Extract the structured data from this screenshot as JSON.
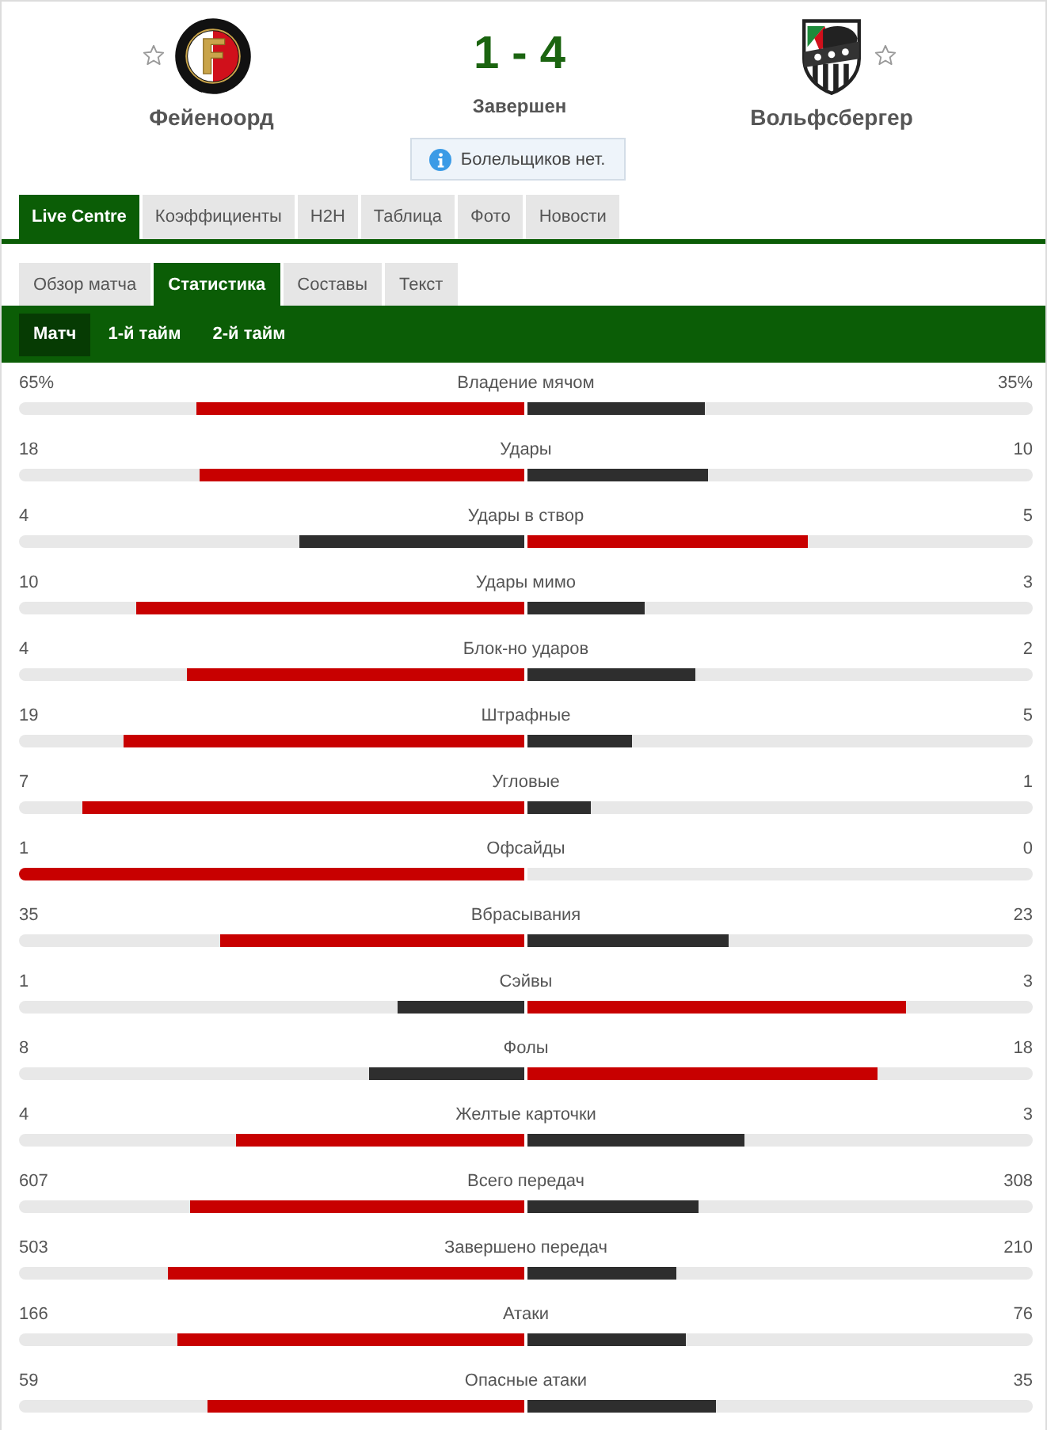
{
  "match": {
    "home": {
      "name": "Фейеноорд",
      "favorite": false
    },
    "score": "1 - 4",
    "status": "Завершен",
    "away": {
      "name": "Вольфсбергер",
      "favorite": false
    },
    "fans_note": "Болельщиков нет."
  },
  "tabs": [
    {
      "label": "Live Centre",
      "selected": true
    },
    {
      "label": "Коэффициенты",
      "selected": false
    },
    {
      "label": "H2H",
      "selected": false
    },
    {
      "label": "Таблица",
      "selected": false
    },
    {
      "label": "Фото",
      "selected": false
    },
    {
      "label": "Новости",
      "selected": false
    }
  ],
  "subtabs": [
    {
      "label": "Обзор матча",
      "selected": false
    },
    {
      "label": "Статистика",
      "selected": true
    },
    {
      "label": "Составы",
      "selected": false
    },
    {
      "label": "Текст",
      "selected": false
    }
  ],
  "period_tabs": [
    {
      "label": "Матч",
      "selected": true
    },
    {
      "label": "1-й тайм",
      "selected": false
    },
    {
      "label": "2-й тайм",
      "selected": false
    }
  ],
  "stats": [
    {
      "label": "Владение мячом",
      "home": {
        "value": "65%",
        "level": 0.65,
        "leading": true
      },
      "away": {
        "value": "35%",
        "level": 0.35,
        "leading": false
      }
    },
    {
      "label": "Удары",
      "home": {
        "value": "18",
        "level": 0.643,
        "leading": true
      },
      "away": {
        "value": "10",
        "level": 0.357,
        "leading": false
      }
    },
    {
      "label": "Удары в створ",
      "home": {
        "value": "4",
        "level": 0.444,
        "leading": false
      },
      "away": {
        "value": "5",
        "level": 0.556,
        "leading": true
      }
    },
    {
      "label": "Удары мимо",
      "home": {
        "value": "10",
        "level": 0.769,
        "leading": true
      },
      "away": {
        "value": "3",
        "level": 0.231,
        "leading": false
      }
    },
    {
      "label": "Блок-но ударов",
      "home": {
        "value": "4",
        "level": 0.667,
        "leading": true
      },
      "away": {
        "value": "2",
        "level": 0.333,
        "leading": false
      }
    },
    {
      "label": "Штрафные",
      "home": {
        "value": "19",
        "level": 0.792,
        "leading": true
      },
      "away": {
        "value": "5",
        "level": 0.208,
        "leading": false
      }
    },
    {
      "label": "Угловые",
      "home": {
        "value": "7",
        "level": 0.875,
        "leading": true
      },
      "away": {
        "value": "1",
        "level": 0.125,
        "leading": false
      }
    },
    {
      "label": "Офсайды",
      "home": {
        "value": "1",
        "level": 1,
        "leading": true
      },
      "away": {
        "value": "0"
      }
    },
    {
      "label": "Вбрасывания",
      "home": {
        "value": "35",
        "level": 0.603,
        "leading": true
      },
      "away": {
        "value": "23",
        "level": 0.397,
        "leading": false
      }
    },
    {
      "label": "Сэйвы",
      "home": {
        "value": "1",
        "level": 0.25,
        "leading": false
      },
      "away": {
        "value": "3",
        "level": 0.75,
        "leading": true
      }
    },
    {
      "label": "Фолы",
      "home": {
        "value": "8",
        "level": 0.308,
        "leading": false
      },
      "away": {
        "value": "18",
        "level": 0.692,
        "leading": true
      }
    },
    {
      "label": "Желтые карточки",
      "home": {
        "value": "4",
        "level": 0.571,
        "leading": true
      },
      "away": {
        "value": "3",
        "level": 0.429,
        "leading": false
      }
    },
    {
      "label": "Всего передач",
      "home": {
        "value": "607",
        "level": 0.663,
        "leading": true
      },
      "away": {
        "value": "308",
        "level": 0.337,
        "leading": false
      }
    },
    {
      "label": "Завершено передач",
      "home": {
        "value": "503",
        "level": 0.705,
        "leading": true
      },
      "away": {
        "value": "210",
        "level": 0.295,
        "leading": false
      }
    },
    {
      "label": "Атаки",
      "home": {
        "value": "166",
        "level": 0.686,
        "leading": true
      },
      "away": {
        "value": "76",
        "level": 0.314,
        "leading": false
      }
    },
    {
      "label": "Опасные атаки",
      "home": {
        "value": "59",
        "level": 0.628,
        "leading": true
      },
      "away": {
        "value": "35",
        "level": 0.372,
        "leading": false
      }
    }
  ]
}
